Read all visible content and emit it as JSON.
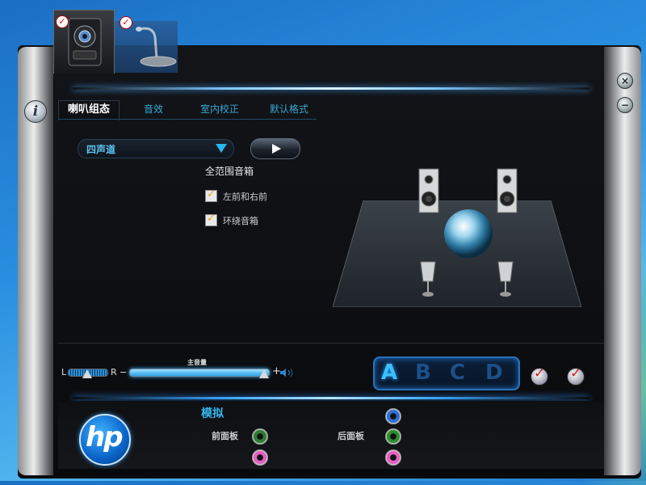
{
  "device_tabs": [
    {
      "name": "speaker",
      "checked": true
    },
    {
      "name": "microphone",
      "checked": true
    }
  ],
  "window_controls": {
    "close_icon": "close-icon",
    "minimize_icon": "minimize-icon",
    "info_label": "i"
  },
  "tabs": [
    {
      "label": "喇叭组态",
      "active": true
    },
    {
      "label": "音效",
      "active": false
    },
    {
      "label": "室内校正",
      "active": false
    },
    {
      "label": "默认格式",
      "active": false
    }
  ],
  "speaker_config": {
    "selected": "四声道",
    "fullrange_title": "全范围音箱",
    "options": [
      {
        "label": "左前和右前",
        "checked": true
      },
      {
        "label": "环绕音箱",
        "checked": true
      }
    ]
  },
  "volume": {
    "left_label": "L",
    "right_label": "R",
    "minus": "−",
    "plus": "+",
    "main_label": "主音量",
    "balance": 0.5,
    "level": 1.0
  },
  "profiles": {
    "letters": [
      "A",
      "B",
      "C",
      "D"
    ],
    "selected": "A"
  },
  "accent": {
    "blue": "#29b7f0",
    "active_letter": "#3cc0ff",
    "inactive_letter": "#1d4f8a"
  },
  "bottom": {
    "logo": "hp",
    "analog_label": "模拟",
    "front_panel_label": "前面板",
    "rear_panel_label": "后面板",
    "front_jacks": [
      "#2e7d32",
      "#e060c0"
    ],
    "rear_jacks": [
      "#2f6fd6",
      "#2e8b2e",
      "#e060c0"
    ]
  }
}
